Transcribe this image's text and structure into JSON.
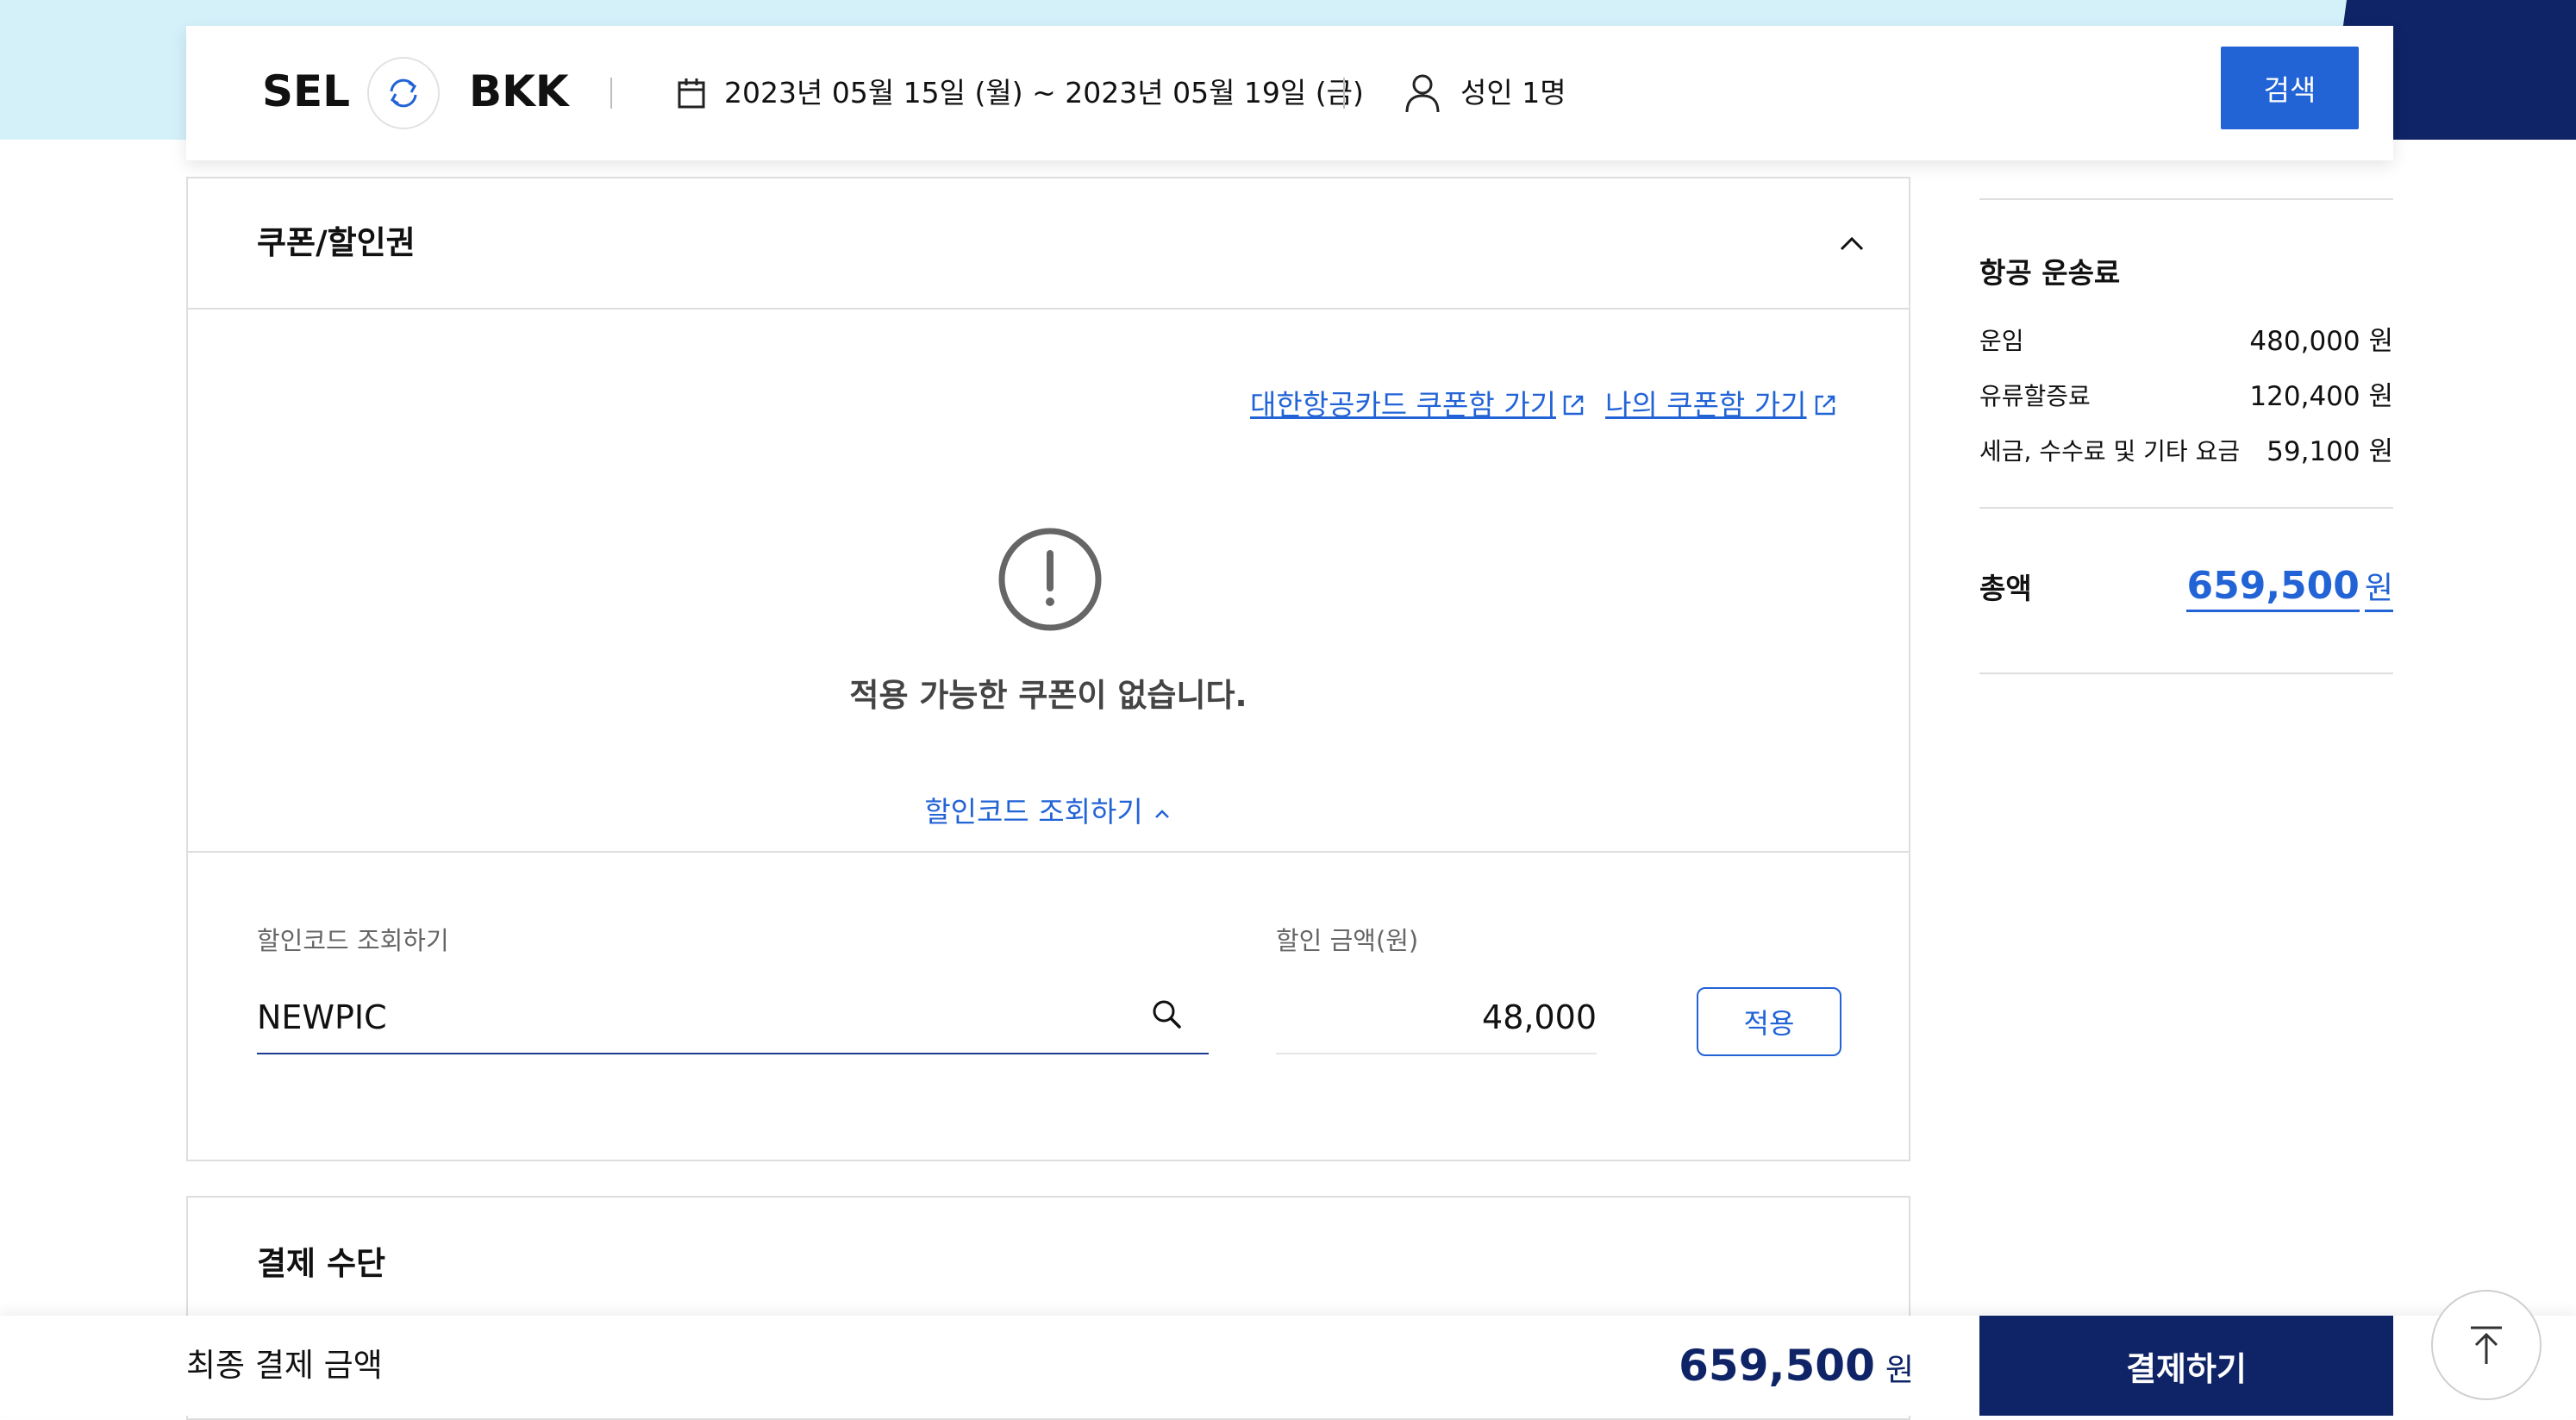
{
  "search": {
    "origin": "SEL",
    "destination": "BKK",
    "dates": "2023년 05월 15일 (월) ~ 2023년 05월 19일 (금)",
    "passengers": "성인 1명",
    "search_button": "검색"
  },
  "coupon": {
    "title": "쿠폰/할인권",
    "card_coupon_link": "대한항공카드 쿠폰함 가기",
    "my_coupon_link": "나의 쿠폰함 가기",
    "empty_message": "적용 가능한 쿠폰이 없습니다.",
    "code_toggle": "할인코드 조회하기",
    "code_label": "할인코드 조회하기",
    "code_value": "NEWPIC",
    "amount_label": "할인 금액(원)",
    "amount_value": "48,000",
    "apply_button": "적용"
  },
  "payment_method": {
    "title": "결제 수단"
  },
  "fare_summary": {
    "title": "항공 운송료",
    "items": [
      {
        "label": "운임",
        "value": "480,000 원"
      },
      {
        "label": "유류할증료",
        "value": "120,400 원"
      },
      {
        "label": "세금, 수수료 및 기타 요금",
        "value": "59,100 원"
      }
    ],
    "total_label": "총액",
    "total_value": "659,500",
    "total_unit": "원"
  },
  "bottom_bar": {
    "final_label": "최종 결제 금액",
    "final_value": "659,500",
    "final_unit": "원",
    "pay_button": "결제하기"
  },
  "icons": {
    "swap": "swap-icon",
    "calendar": "calendar-icon",
    "person": "person-icon",
    "collapse": "chevron-up-icon",
    "external": "external-link-icon",
    "alert": "alert-circle-icon",
    "search": "search-icon",
    "back_to_top": "arrow-up-icon"
  },
  "colors": {
    "accent_blue": "#2263d6",
    "navy": "#0f2467",
    "header_bg": "#d4f0f9"
  }
}
